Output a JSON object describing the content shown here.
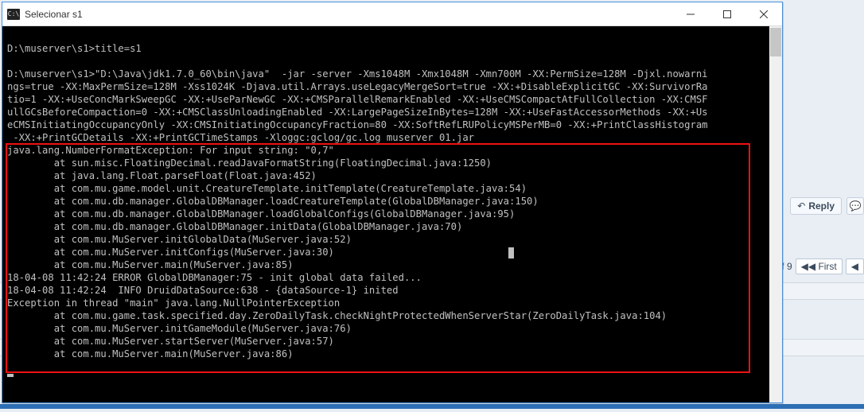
{
  "window": {
    "title": "Selecionar s1"
  },
  "forum": {
    "reply": "Reply",
    "of": "f 9",
    "first": "First"
  },
  "console": {
    "lines": [
      "",
      "D:\\muserver\\s1>title=s1",
      "",
      "D:\\muserver\\s1>\"D:\\Java\\jdk1.7.0_60\\bin\\java\"  -jar -server -Xms1048M -Xmx1048M -Xmn700M -XX:PermSize=128M -Djxl.nowarni",
      "ngs=true -XX:MaxPermSize=128M -Xss1024K -Djava.util.Arrays.useLegacyMergeSort=true -XX:+DisableExplicitGC -XX:SurvivorRa",
      "tio=1 -XX:+UseConcMarkSweepGC -XX:+UseParNewGC -XX:+CMSParallelRemarkEnabled -XX:+UseCMSCompactAtFullCollection -XX:CMSF",
      "ullGCsBeforeCompaction=0 -XX:+CMSClassUnloadingEnabled -XX:LargePageSizeInBytes=128M -XX:+UseFastAccessorMethods -XX:+Us",
      "eCMSInitiatingOccupancyOnly -XX:CMSInitiatingOccupancyFraction=80 -XX:SoftRefLRUPolicyMSPerMB=0 -XX:+PrintClassHistogram",
      " -XX:+PrintGCDetails -XX:+PrintGCTimeStamps -Xloggc:gclog/gc.log muserver 01.jar",
      "java.lang.NumberFormatException: For input string: \"0,7\"",
      "        at sun.misc.FloatingDecimal.readJavaFormatString(FloatingDecimal.java:1250)",
      "        at java.lang.Float.parseFloat(Float.java:452)",
      "        at com.mu.game.model.unit.CreatureTemplate.initTemplate(CreatureTemplate.java:54)",
      "        at com.mu.db.manager.GlobalDBManager.loadCreatureTemplate(GlobalDBManager.java:150)",
      "        at com.mu.db.manager.GlobalDBManager.loadGlobalConfigs(GlobalDBManager.java:95)",
      "        at com.mu.db.manager.GlobalDBManager.initData(GlobalDBManager.java:70)",
      "        at com.mu.MuServer.initGlobalData(MuServer.java:52)",
      "        at com.mu.MuServer.initConfigs(MuServer.java:30)",
      "        at com.mu.MuServer.main(MuServer.java:85)",
      "18-04-08 11:42:24 ERROR GlobalDBManager:75 - init global data failed...",
      "18-04-08 11:42:24  INFO DruidDataSource:638 - {dataSource-1} inited",
      "Exception in thread \"main\" java.lang.NullPointerException",
      "        at com.mu.game.task.specified.day.ZeroDailyTask.checkNightProtectedWhenServerStar(ZeroDailyTask.java:104)",
      "        at com.mu.MuServer.initGameModule(MuServer.java:76)",
      "        at com.mu.MuServer.startServer(MuServer.java:57)",
      "        at com.mu.MuServer.main(MuServer.java:86)"
    ]
  }
}
